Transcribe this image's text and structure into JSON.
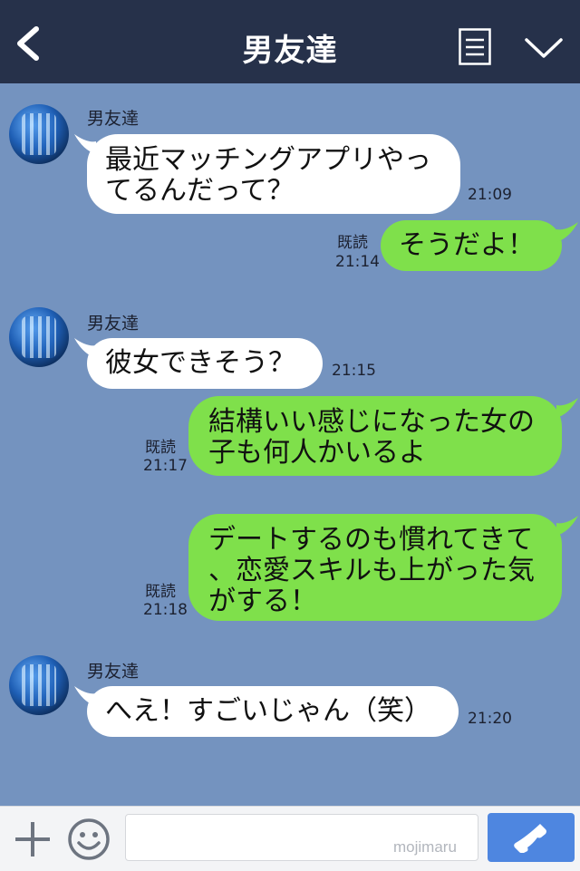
{
  "header": {
    "title": "男友達",
    "icons": {
      "back": "back-chevron-icon",
      "notes": "notes-icon",
      "menu": "chevron-down-icon"
    }
  },
  "messages": [
    {
      "side": "in",
      "sender": "男友達",
      "text": "最近マッチングアプリやっ\nてるんだって？",
      "time": "21:09"
    },
    {
      "side": "out",
      "read": "既読",
      "text": "そうだよ！",
      "time": "21:14"
    },
    {
      "side": "in",
      "sender": "男友達",
      "text": "彼女できそう？",
      "time": "21:15"
    },
    {
      "side": "out",
      "read": "既読",
      "text": "結構いい感じになった女の\n子も何人かいるよ",
      "time": "21:17"
    },
    {
      "side": "out",
      "read": "既読",
      "text": "デートするのも慣れてきて\n、恋愛スキルも上がった気\nがする！",
      "time": "21:18"
    },
    {
      "side": "in",
      "sender": "男友達",
      "text": "へえ！すごいじゃん（笑）",
      "time": "21:20"
    }
  ],
  "input_bar": {
    "watermark": "mojimaru",
    "icons": {
      "add": "plus-icon",
      "emoji": "smile-icon",
      "call": "phone-icon"
    }
  },
  "colors": {
    "header_bg": "#26314a",
    "chat_bg": "#7493bf",
    "bubble_in": "#ffffff",
    "bubble_out": "#7fe04b",
    "call_button": "#4e86e0"
  }
}
